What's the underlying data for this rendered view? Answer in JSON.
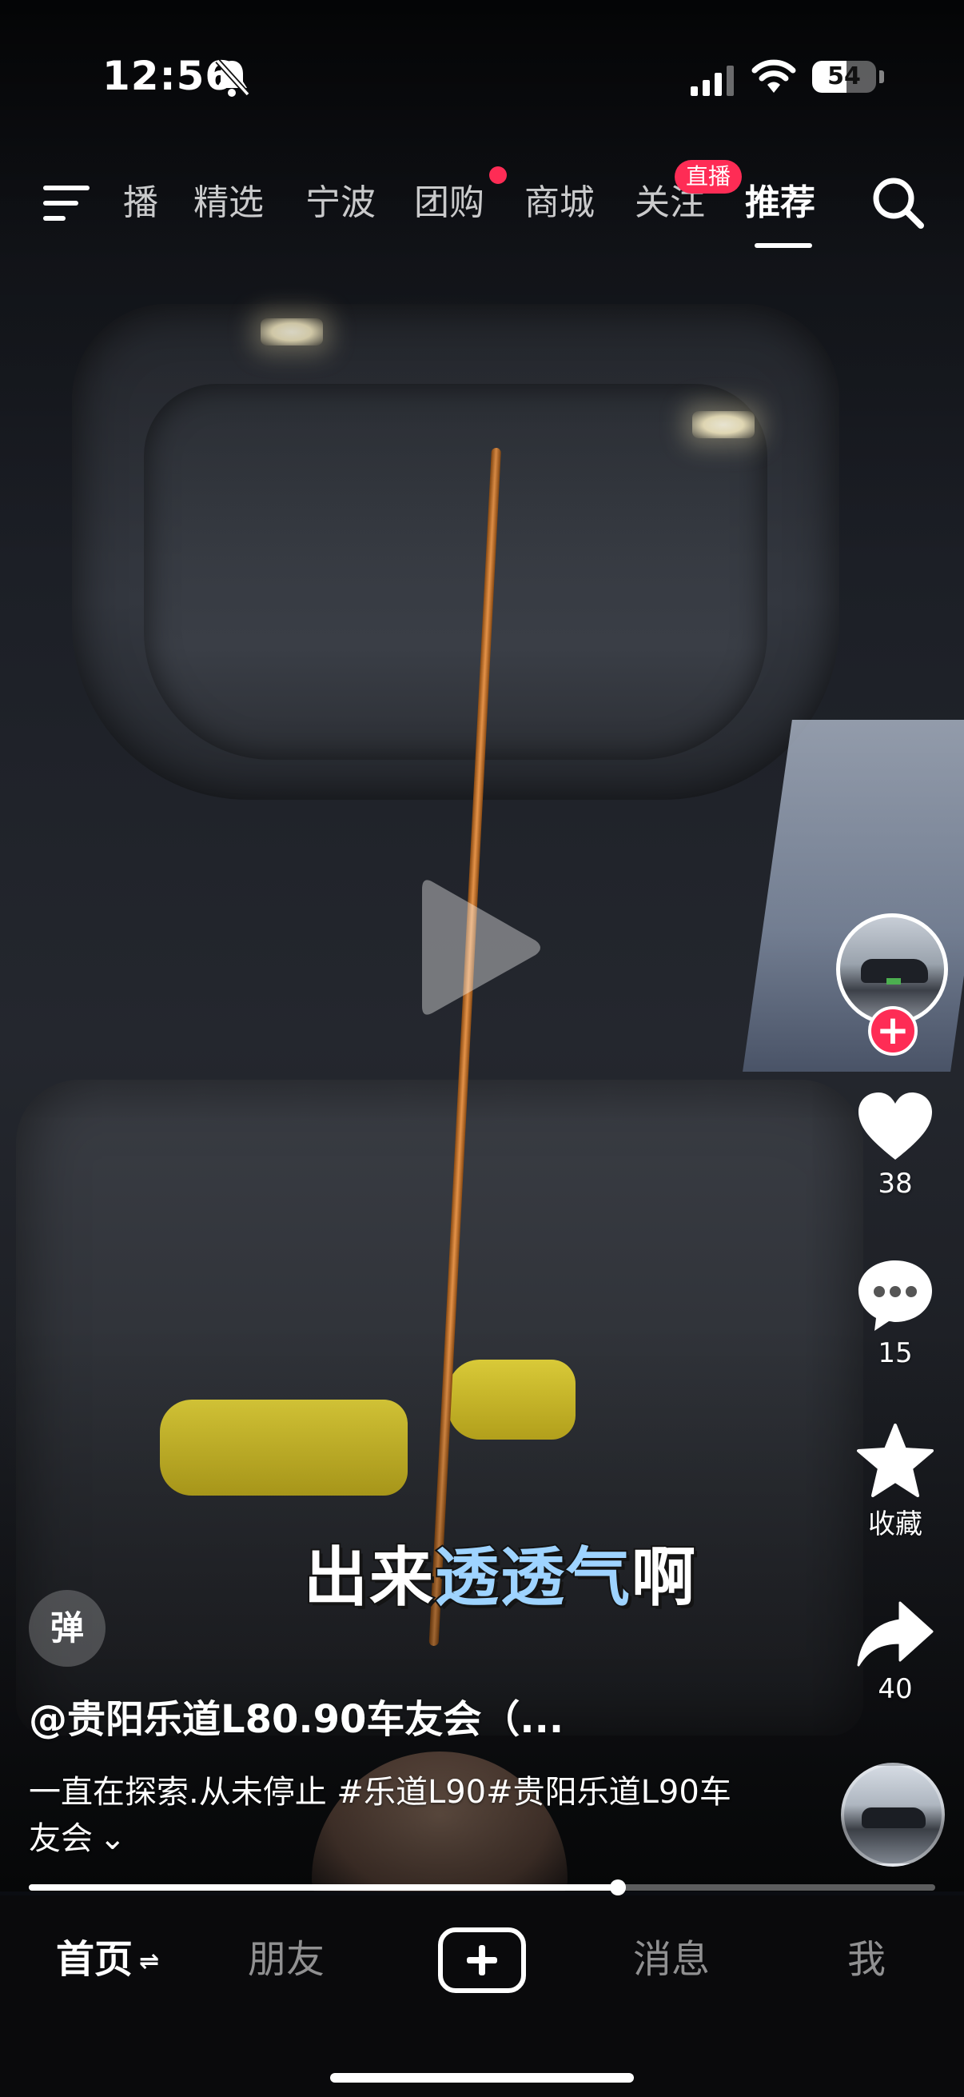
{
  "status_bar": {
    "time": "12:56",
    "battery_level": "54",
    "battery_fraction": 0.54,
    "icons": [
      "bell-muted-icon",
      "signal-icon",
      "wifi-icon",
      "battery-icon"
    ]
  },
  "top_nav": {
    "tabs": [
      {
        "label": "播"
      },
      {
        "label": "精选"
      },
      {
        "label": "宁波"
      },
      {
        "label": "团购"
      },
      {
        "label": "商城"
      },
      {
        "label": "关注"
      },
      {
        "label": "推荐"
      }
    ],
    "active_tab": "推荐",
    "live_badge": "直播",
    "icons": [
      "menu-icon",
      "search-icon"
    ]
  },
  "video": {
    "state": "paused",
    "subtitle_plain_1": "出来",
    "subtitle_highlight": "透透气",
    "subtitle_plain_2": "啊",
    "progress_fraction": 0.65
  },
  "right_rail": {
    "follow_symbol": "+",
    "like_count": "38",
    "comment_count": "15",
    "favorite_label": "收藏",
    "share_count": "40",
    "icons": [
      "heart-icon",
      "comment-icon",
      "star-icon",
      "share-icon"
    ]
  },
  "info": {
    "danmaku_label": "弹",
    "author": "@贵阳乐道L80.90车友会（...",
    "description": "一直在探索.从未停止 #乐道L90#贵阳乐道L90车友会",
    "expand_symbol": "⌄"
  },
  "bottom_bar": {
    "tabs": [
      {
        "label": "首页"
      },
      {
        "label": "朋友"
      },
      {
        "label": "消息"
      },
      {
        "label": "我"
      }
    ],
    "active_tab": "首页",
    "swap_symbol": "⇌",
    "icons": [
      "plus-icon"
    ]
  },
  "colors": {
    "accent": "#fe2c55",
    "subtitle_highlight": "#9ed3ff",
    "bar_background": "#0a0a0c"
  }
}
